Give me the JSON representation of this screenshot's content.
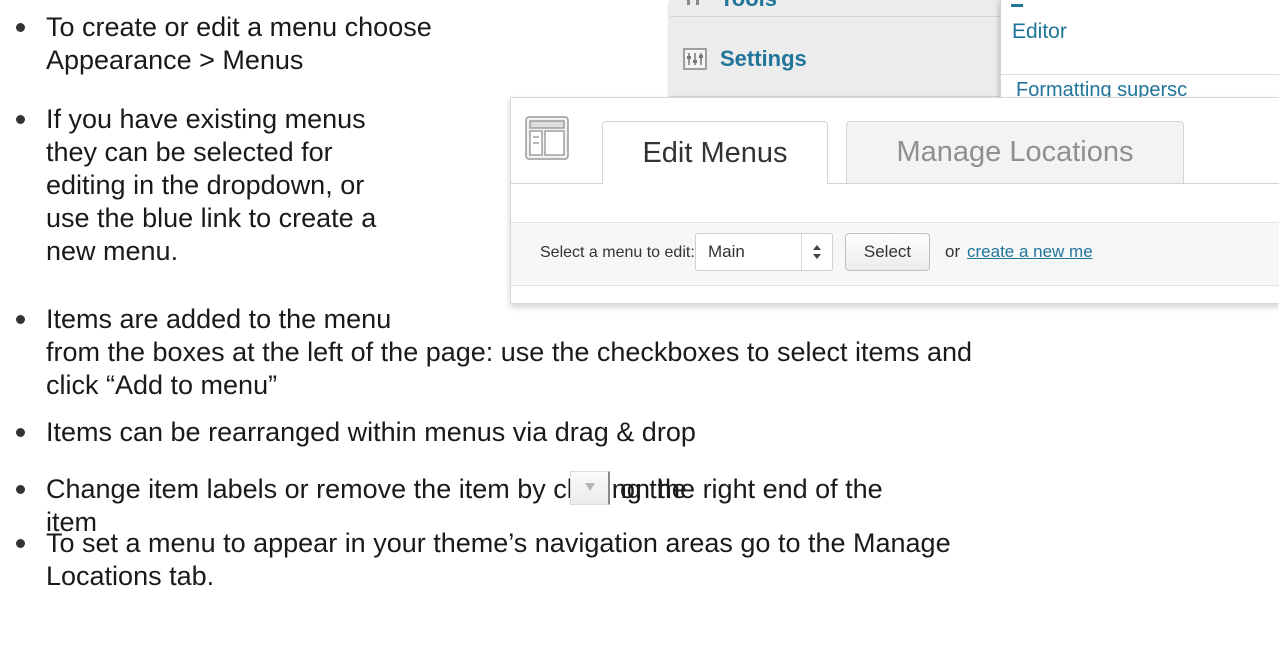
{
  "bullets": [
    {
      "lines": [
        "To create or edit a menu choose",
        "Appearance > Menus"
      ]
    },
    {
      "lines": [
        "If you have existing menus",
        "they can be selected for",
        "editing in the dropdown, or",
        "use the blue link to create a",
        "new menu."
      ]
    },
    {
      "lines": [
        "Items are added to the menu",
        "from the boxes at the left of the page: use the checkboxes to select items and",
        "click “Add to menu”"
      ]
    },
    {
      "lines": [
        "Items can be rearranged within menus via drag & drop"
      ]
    },
    {
      "lines": [
        "Change item labels or remove the item by clicking the",
        "on the right end of the",
        "item"
      ]
    },
    {
      "lines": [
        "To set a menu to appear in your theme’s navigation areas go to the Manage",
        "Locations tab."
      ]
    }
  ],
  "admin_menu": {
    "tools_label": "Tools",
    "settings_label": "Settings",
    "flyout": {
      "editor_label": "Editor",
      "formatting_label": "Formatting supersc"
    }
  },
  "menus_screen": {
    "tabs": [
      {
        "label": "Edit Menus",
        "active": true
      },
      {
        "label": "Manage Locations",
        "active": false
      }
    ],
    "select_label": "Select a menu to edit:",
    "selected_menu": "Main",
    "select_button": "Select",
    "or_text": "or",
    "create_link": "create a new me"
  },
  "icons": {
    "tools": "tools-icon",
    "settings": "settings-icon",
    "screen": "menus-screen-icon",
    "select_arrows": "updown-arrows-icon",
    "item_toggle": "triangle-down-icon"
  },
  "colors": {
    "link": "#21759b",
    "text": "#1a1a1a"
  }
}
